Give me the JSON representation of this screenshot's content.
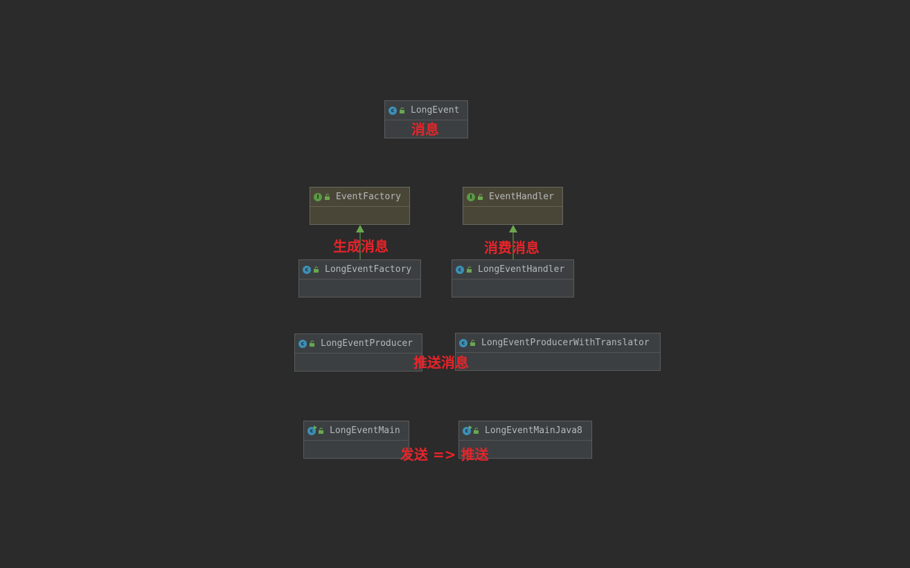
{
  "diagram": {
    "background": "#2b2b2b",
    "accent_annotation": "#e8242a",
    "nodes": [
      {
        "id": "long-event",
        "name": "LongEvent",
        "kind": "class",
        "icon": "class-icon"
      },
      {
        "id": "event-factory",
        "name": "EventFactory",
        "kind": "interface",
        "icon": "interface-icon"
      },
      {
        "id": "event-handler",
        "name": "EventHandler",
        "kind": "interface",
        "icon": "interface-icon"
      },
      {
        "id": "long-event-factory",
        "name": "LongEventFactory",
        "kind": "class",
        "icon": "class-icon"
      },
      {
        "id": "long-event-handler",
        "name": "LongEventHandler",
        "kind": "class",
        "icon": "class-icon"
      },
      {
        "id": "long-event-producer",
        "name": "LongEventProducer",
        "kind": "class",
        "icon": "class-icon"
      },
      {
        "id": "long-event-producer-translator",
        "name": "LongEventProducerWithTranslator",
        "kind": "class",
        "icon": "class-icon"
      },
      {
        "id": "long-event-main",
        "name": "LongEventMain",
        "kind": "runnable-class",
        "icon": "runnable-class-icon"
      },
      {
        "id": "long-event-main-java8",
        "name": "LongEventMainJava8",
        "kind": "runnable-class",
        "icon": "runnable-class-icon"
      }
    ],
    "edges": [
      {
        "from": "long-event-factory",
        "to": "event-factory",
        "type": "implements"
      },
      {
        "from": "long-event-handler",
        "to": "event-handler",
        "type": "implements"
      }
    ],
    "annotations": {
      "message": "消息",
      "generate_message": "生成消息",
      "consume_message": "消费消息",
      "push_message": "推送消息",
      "send_push": "发送 => 推送"
    }
  }
}
